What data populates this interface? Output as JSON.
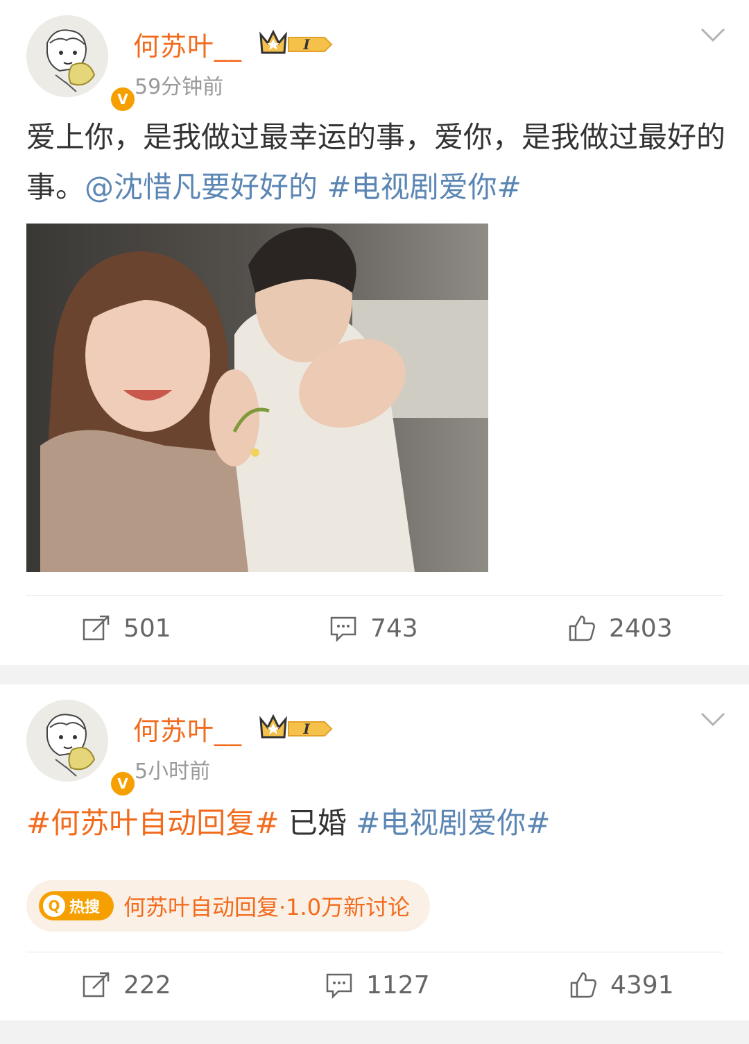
{
  "posts": [
    {
      "username": "何苏叶__",
      "time": "59分钟前",
      "text_plain": "爱上你，是我做过最幸运的事，爱你，是我做过最好的事。",
      "mention": "@沈惜凡要好好的",
      "topic": "#电视剧爱你#",
      "stats": {
        "repost": "501",
        "comment": "743",
        "like": "2403"
      }
    },
    {
      "username": "何苏叶__",
      "time": "5小时前",
      "topic_orange": "#何苏叶自动回复#",
      "text_plain": " 已婚 ",
      "topic": "#电视剧爱你#",
      "hot_badge": "热搜",
      "hot_search": "何苏叶自动回复·1.0万新讨论",
      "stats": {
        "repost": "222",
        "comment": "1127",
        "like": "4391"
      }
    }
  ],
  "badges": {
    "verified": "V",
    "level": "I"
  },
  "colors": {
    "username": "#f26b1d",
    "link": "#5b86b4",
    "badge": "#f5a000",
    "separator": "#f2f2f2"
  }
}
